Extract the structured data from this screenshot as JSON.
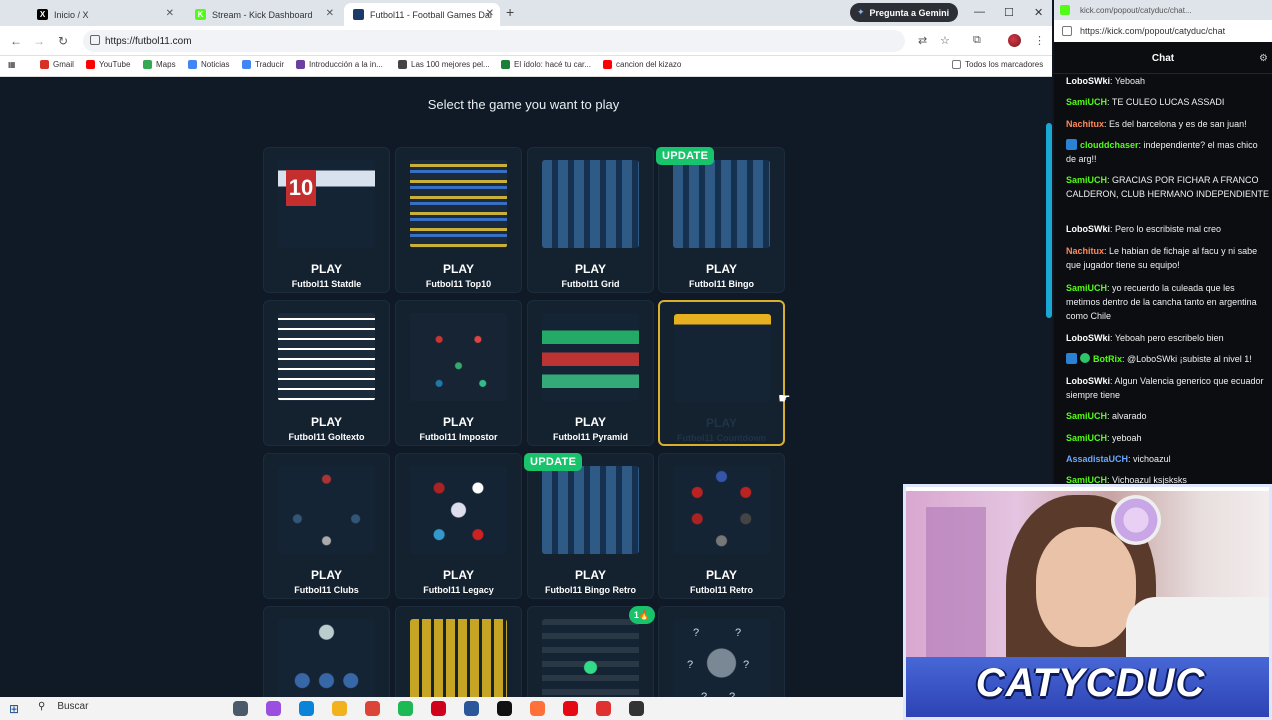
{
  "browser": {
    "tabs": [
      {
        "title": "Inicio / X",
        "favicon_color": "#000000",
        "favicon_text": "X",
        "active": false
      },
      {
        "title": "Stream - Kick Dashboard",
        "favicon_color": "#53fc18",
        "favicon_text": "K",
        "active": false
      },
      {
        "title": "Futbol11 - Football Games Dai",
        "favicon_color": "#1a3a6a",
        "favicon_text": "",
        "active": true
      }
    ],
    "gemini_label": "Pregunta a Gemini",
    "url": "https://futbol11.com",
    "bookmarks": [
      {
        "label": "Gmail",
        "color": "#d93025"
      },
      {
        "label": "YouTube",
        "color": "#ff0000"
      },
      {
        "label": "Maps",
        "color": "#34a853"
      },
      {
        "label": "Noticias",
        "color": "#4285f4"
      },
      {
        "label": "Traducir",
        "color": "#4285f4"
      },
      {
        "label": "Introducción a la in...",
        "color": "#6b3fa0"
      },
      {
        "label": "Las 100 mejores pel...",
        "color": "#444444"
      },
      {
        "label": "El ídolo: hacé tu car...",
        "color": "#1b7f3a"
      },
      {
        "label": "cancion del kizazo",
        "color": "#ff0000"
      }
    ],
    "bookmarks_all": "Todos los marcadores"
  },
  "page": {
    "heading": "Select the game you want to play",
    "play_label": "PLAY",
    "update_label": "UPDATE",
    "coin_label": "1",
    "stats_number": "10",
    "games": [
      {
        "name": "Futbol11 Statdle",
        "thumb": "th-stats",
        "highlight": false
      },
      {
        "name": "Futbol11 Top10",
        "thumb": "th-flags",
        "highlight": false
      },
      {
        "name": "Futbol11 Grid",
        "thumb": "th-players",
        "highlight": false
      },
      {
        "name": "Futbol11 Bingo",
        "thumb": "th-players",
        "highlight": false
      },
      {
        "name": "Futbol11 Goltexto",
        "thumb": "th-bars",
        "highlight": false
      },
      {
        "name": "Futbol11 Impostor",
        "thumb": "th-dots",
        "highlight": false
      },
      {
        "name": "Futbol11 Pyramid",
        "thumb": "th-pyr",
        "highlight": false
      },
      {
        "name": "Futbol11 Countdown",
        "thumb": "th-bingo",
        "highlight": true
      },
      {
        "name": "Futbol11 Clubs",
        "thumb": "th-clubs",
        "highlight": false
      },
      {
        "name": "Futbol11 Legacy",
        "thumb": "th-legacy",
        "highlight": false
      },
      {
        "name": "Futbol11 Bingo Retro",
        "thumb": "th-players",
        "highlight": false
      },
      {
        "name": "Futbol11 Retro",
        "thumb": "th-retro",
        "highlight": false
      },
      {
        "name": "",
        "thumb": "th-tree",
        "highlight": false
      },
      {
        "name": "",
        "thumb": "th-wordle",
        "highlight": false
      },
      {
        "name": "",
        "thumb": "th-check",
        "highlight": false
      },
      {
        "name": "",
        "thumb": "th-mystery",
        "highlight": false
      }
    ]
  },
  "taskbar": {
    "search_label": "Buscar",
    "apps": [
      "#4a5a6a",
      "#9a4fe0",
      "#0a84d8",
      "#f2b21b",
      "#db4437",
      "#1db954",
      "#d0021b",
      "#2b579a",
      "#111111",
      "#ff7139",
      "#e50914",
      "#e03131",
      "#333333"
    ]
  },
  "chat": {
    "tab_title": "kick.com/popout/catyduc/chat...",
    "url": "https://kick.com/popout/catyduc/chat",
    "header": "Chat",
    "messages": [
      {
        "user": "LoboSWki",
        "color": "#ffffff",
        "text": "Yeboah"
      },
      {
        "user": "SamiUCH",
        "color": "#53fc18",
        "text": "TE CULEO LUCAS ASSADI"
      },
      {
        "user": "Nachitux",
        "color": "#ff8a5b",
        "text": "Es del barcelona y es de san juan!"
      },
      {
        "user": "clouddchaser",
        "color": "#53fc18",
        "text": "independiente? el mas chico de arg!!",
        "badge": "v"
      },
      {
        "user": "SamiUCH",
        "color": "#53fc18",
        "text": "GRACIAS POR FICHAR A FRANCO CALDERON, CLUB HERMANO INDEPENDIENTE"
      },
      {
        "user": "LoboSWki",
        "color": "#ffffff",
        "text": "Pero lo escribiste mal creo"
      },
      {
        "user": "Nachitux",
        "color": "#ff8a5b",
        "text": "Le habian de fichaje al facu y ni sabe que jugador tiene su equipo!"
      },
      {
        "user": "SamiUCH",
        "color": "#53fc18",
        "text": "yo recuerdo la culeada que les metimos dentro de la cancha tanto en argentina como Chile"
      },
      {
        "user": "LoboSWki",
        "color": "#ffffff",
        "text": "Yeboah pero escribelo bien"
      },
      {
        "user": "BotRix",
        "color": "#53fc18",
        "text": "@LoboSWki ¡subiste al nivel 1!",
        "badge": "vg"
      },
      {
        "user": "LoboSWki",
        "color": "#ffffff",
        "text": "Algun Valencia generico que ecuador siempre tiene"
      },
      {
        "user": "SamiUCH",
        "color": "#53fc18",
        "text": "alvarado"
      },
      {
        "user": "SamiUCH",
        "color": "#53fc18",
        "text": "yeboah"
      },
      {
        "user": "AssadistaUCH",
        "color": "#6aa8ff",
        "text": "vichoazul"
      },
      {
        "user": "SamiUCH",
        "color": "#53fc18",
        "text": "Vichoazul ksjsksks"
      }
    ]
  },
  "overlay": {
    "brand": "CATYCDUC"
  }
}
